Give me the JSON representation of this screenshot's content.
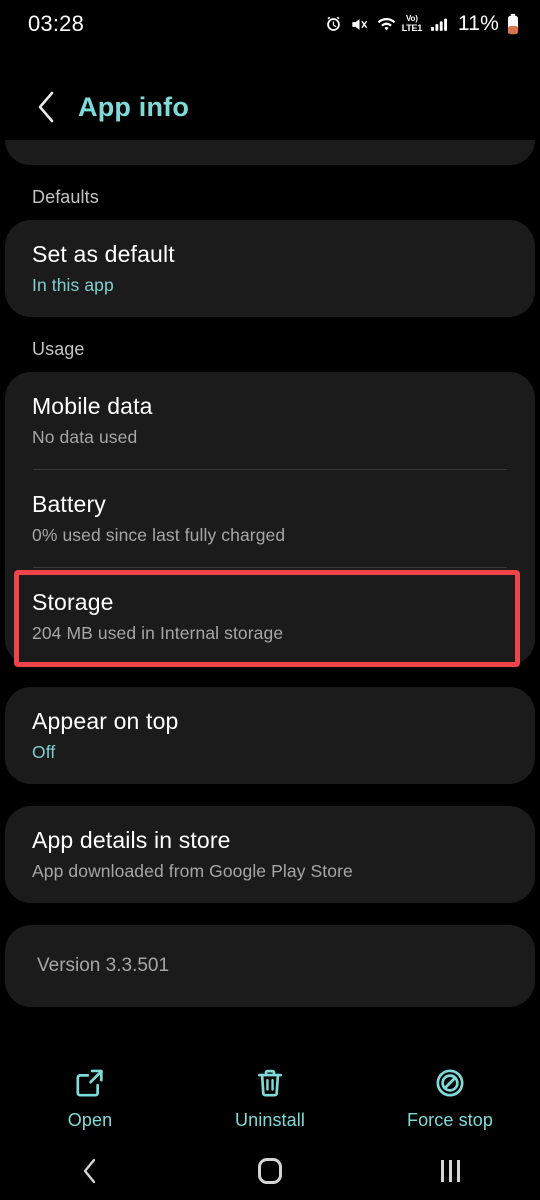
{
  "status_bar": {
    "time": "03:28",
    "battery_percent": "11%",
    "network_label_top": "Vo)",
    "network_label_bottom": "LTE1",
    "icons": [
      "alarm-icon",
      "mute-icon",
      "wifi-icon",
      "volte-icon",
      "signal-icon",
      "battery-icon"
    ]
  },
  "header": {
    "title": "App info",
    "back_icon": "chevron-left-icon"
  },
  "sections": [
    {
      "label": "Defaults",
      "rows": [
        {
          "title": "Set as default",
          "sub": "In this app",
          "sub_accent": true
        }
      ]
    },
    {
      "label": "Usage",
      "rows": [
        {
          "title": "Mobile data",
          "sub": "No data used",
          "sub_accent": false
        },
        {
          "title": "Battery",
          "sub": "0% used since last fully charged",
          "sub_accent": false
        }
      ]
    }
  ],
  "storage_card": {
    "title": "Storage",
    "sub": "204 MB used in Internal storage",
    "highlighted": true,
    "highlight_color": "#f1434a"
  },
  "appear_card": {
    "title": "Appear on top",
    "sub": "Off",
    "sub_accent": true
  },
  "store_card": {
    "title": "App details in store",
    "sub": "App downloaded from Google Play Store",
    "sub_accent": false
  },
  "version_card": {
    "text": "Version 3.3.501"
  },
  "actions": [
    {
      "label": "Open",
      "icon": "open-in-new-icon"
    },
    {
      "label": "Uninstall",
      "icon": "trash-icon"
    },
    {
      "label": "Force stop",
      "icon": "block-circle-icon"
    }
  ],
  "nav_bar": {
    "back": "chevron-left-icon",
    "home": "home-square-icon",
    "recents": "recents-lines-icon"
  },
  "colors": {
    "background": "#000000",
    "card": "#1b1b1b",
    "accent_teal": "#7fdbd9",
    "sub_text": "#a6a6a6",
    "section_label": "#c3c3c3",
    "highlight_red": "#f1434a",
    "battery_low": "#e08a5a"
  }
}
